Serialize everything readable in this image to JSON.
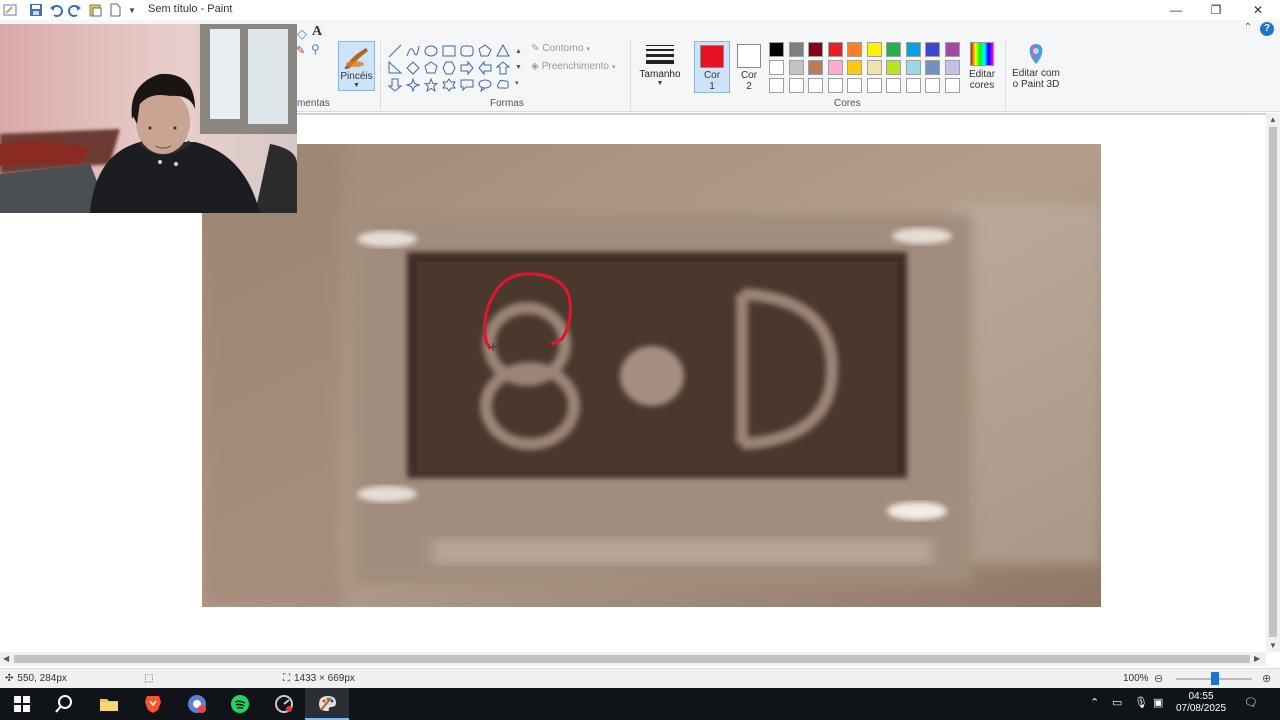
{
  "window": {
    "title": "Sem título - Paint",
    "minimize_glyph": "—",
    "restore_glyph": "❐",
    "close_glyph": "✕"
  },
  "ribbon": {
    "tools_group_label": "mentas",
    "brushes_label": "Pincéis",
    "shapes_group_label": "Formas",
    "outline_label": "Contorno",
    "fill_label": "Preenchimento",
    "size_label": "Tamanho",
    "color1_label_line1": "Cor",
    "color1_label_line2": "1",
    "color2_label_line1": "Cor",
    "color2_label_line2": "2",
    "colors_group_label": "Cores",
    "edit_colors_line1": "Editar",
    "edit_colors_line2": "cores",
    "paint3d_line1": "Editar com",
    "paint3d_line2": "o Paint 3D",
    "help_glyph": "?",
    "color1": "#e81123",
    "color2": "#ffffff",
    "palette": [
      "#000000",
      "#7f7f7f",
      "#880015",
      "#ed1c24",
      "#ff7f27",
      "#fff200",
      "#22b14c",
      "#00a2e8",
      "#3f48cc",
      "#a349a4",
      "#ffffff",
      "#c3c3c3",
      "#b97a57",
      "#ffaec9",
      "#ffc90e",
      "#efe4b0",
      "#b5e61d",
      "#99d9ea",
      "#7092be",
      "#c8bfe7",
      "#ffffff",
      "#ffffff",
      "#ffffff",
      "#ffffff",
      "#ffffff",
      "#ffffff",
      "#ffffff",
      "#ffffff",
      "#ffffff",
      "#ffffff"
    ]
  },
  "status": {
    "cursor_pos": "550, 284px",
    "image_size": "1433 × 669px",
    "zoom": "100%"
  },
  "taskbar": {
    "time": "04:55",
    "date": "07/08/2025"
  }
}
